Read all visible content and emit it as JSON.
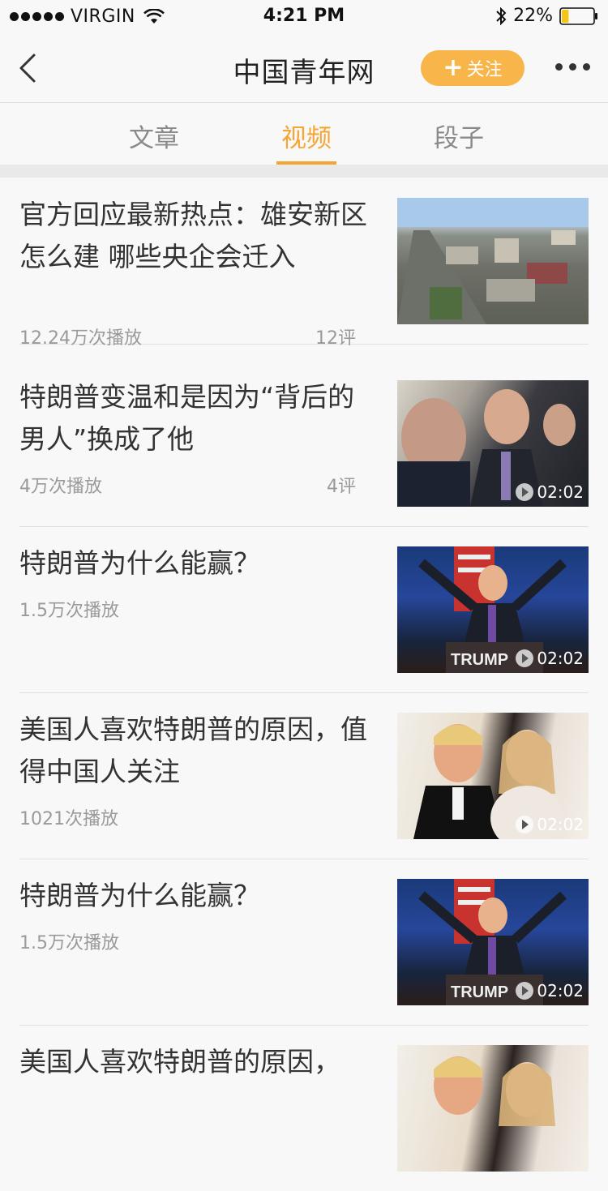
{
  "status_bar": {
    "carrier": "VIRGIN",
    "time": "4:21 PM",
    "battery": "22%",
    "battery_level": 0.22,
    "battery_color": "#f5c518"
  },
  "nav": {
    "title": "中国青年网",
    "follow_label": "关注",
    "follow_plus": "+"
  },
  "colors": {
    "accent": "#f5a534",
    "follow_bg": "#f8b54a"
  },
  "tabs": [
    {
      "label": "文章",
      "active": false
    },
    {
      "label": "视频",
      "active": true
    },
    {
      "label": "段子",
      "active": false
    }
  ],
  "items": [
    {
      "title": "官方回应最新热点：雄安新区怎么建 哪些央企会迁入",
      "plays": "12.24万次播放",
      "comments": "12评",
      "duration": "",
      "thumb_icon": "city-aerial-image"
    },
    {
      "title": "特朗普变温和是因为“背后的男人”换成了他",
      "plays": "4万次播放",
      "comments": "4评",
      "duration": "02:02",
      "thumb_icon": "meeting-image"
    },
    {
      "title": "特朗普为什么能赢？",
      "plays": "1.5万次播放",
      "comments": "",
      "duration": "02:02",
      "thumb_icon": "rally-image"
    },
    {
      "title": "美国人喜欢特朗普的原因，值得中国人关注",
      "plays": "1021次播放",
      "comments": "",
      "duration": "02:02",
      "thumb_icon": "couple-image"
    },
    {
      "title": "特朗普为什么能赢？",
      "plays": "1.5万次播放",
      "comments": "",
      "duration": "02:02",
      "thumb_icon": "rally-image"
    },
    {
      "title": "美国人喜欢特朗普的原因，",
      "plays": "",
      "comments": "",
      "duration": "",
      "thumb_icon": "couple-image"
    }
  ]
}
